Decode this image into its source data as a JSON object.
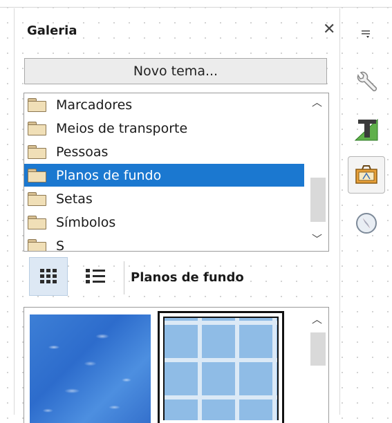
{
  "gallery": {
    "title": "Galeria",
    "close_icon": "close-icon",
    "new_theme_label": "Novo tema...",
    "themes": [
      {
        "label": "Marcadores",
        "selected": false
      },
      {
        "label": "Meios de transporte",
        "selected": false
      },
      {
        "label": "Pessoas",
        "selected": false
      },
      {
        "label": "Planos de fundo",
        "selected": true
      },
      {
        "label": "Setas",
        "selected": false
      },
      {
        "label": "Símbolos",
        "selected": false
      },
      {
        "label": "S",
        "selected": false
      }
    ],
    "view_buttons": [
      {
        "icon": "icon-view-grid-icon",
        "active": true
      },
      {
        "icon": "detailed-list-view-icon",
        "active": false
      }
    ],
    "current_theme": "Planos de fundo",
    "items": [
      {
        "icon": "water-texture-thumbnail",
        "selected": false
      },
      {
        "icon": "blue-tiles-thumbnail",
        "selected": true
      }
    ]
  },
  "sidebar": {
    "buttons": [
      {
        "icon": "sidebar-menu-icon",
        "active": false
      },
      {
        "icon": "properties-wrench-icon",
        "active": false
      },
      {
        "icon": "styles-icon",
        "active": false
      },
      {
        "icon": "gallery-icon",
        "active": true
      },
      {
        "icon": "navigator-compass-icon",
        "active": false
      }
    ]
  },
  "colors": {
    "selection": "#1b78d0",
    "panel_border": "#9a9a9a",
    "button_bg": "#ececec"
  }
}
